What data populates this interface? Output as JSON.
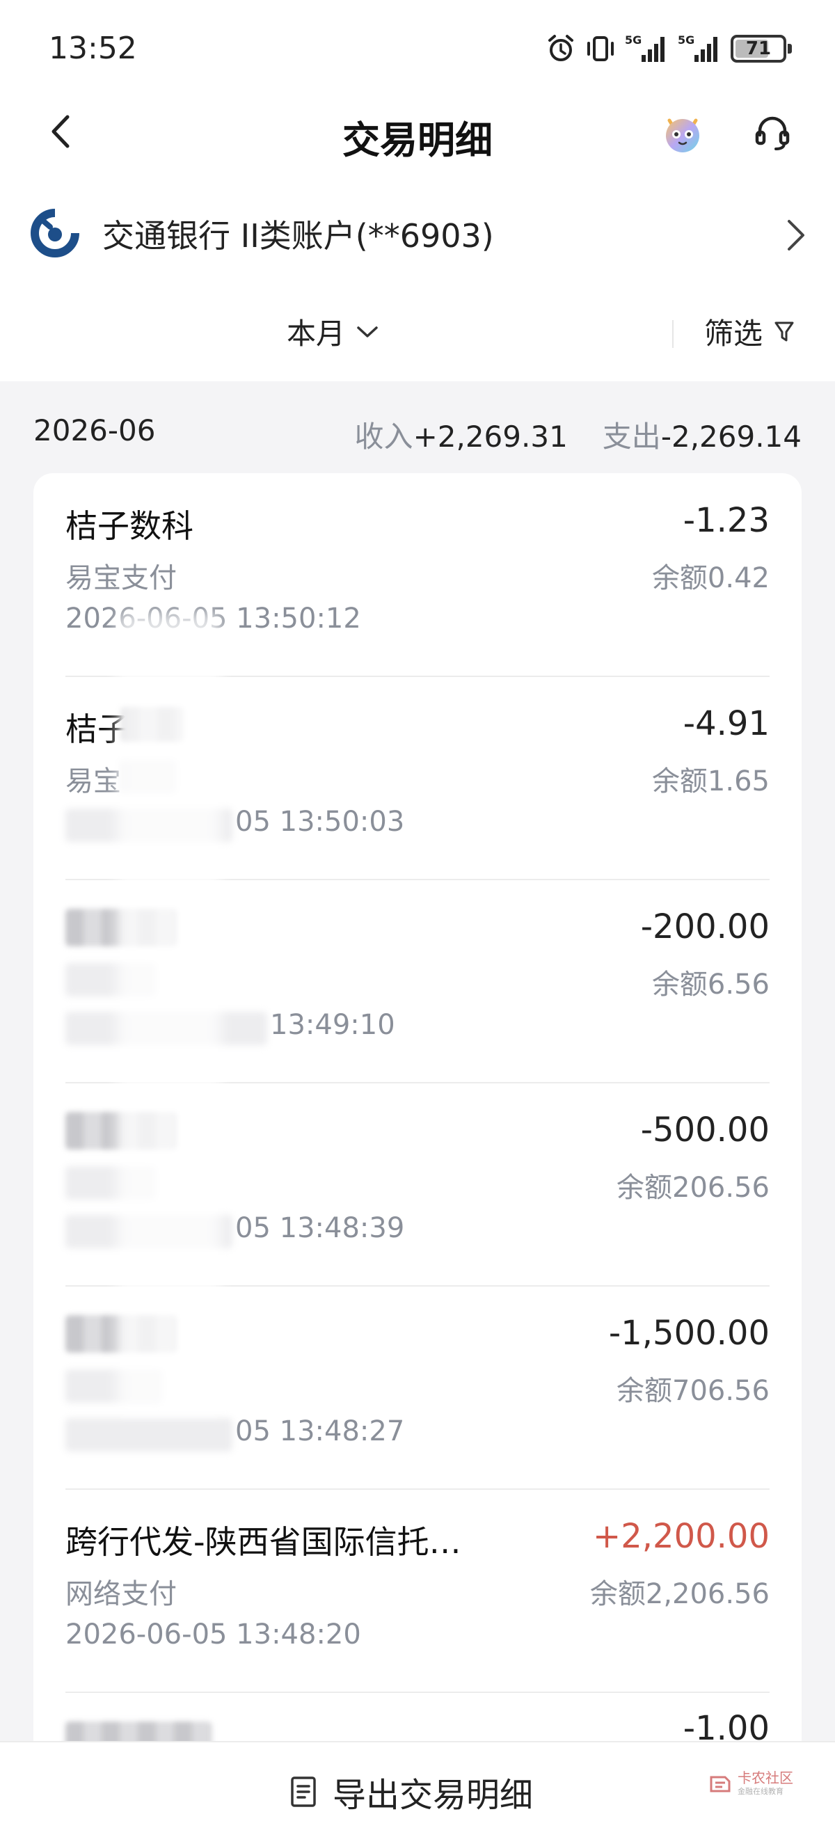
{
  "status_bar": {
    "time": "13:52",
    "battery": "71",
    "battery_level": 0.71,
    "network_1": "5G",
    "network_2": "5G"
  },
  "header": {
    "title": "交易明细",
    "back_icon": "chevron-left-icon",
    "service_icon": "headset-icon",
    "mascot_icon": "mascot-icon"
  },
  "account": {
    "name": "交通银行 II类账户(**6903)",
    "logo_icon": "bocom-logo-icon"
  },
  "filters": {
    "period": "本月",
    "filter": "筛选"
  },
  "summary": {
    "month": "2026-06",
    "income_label": "收入",
    "income_value": "+2,269.31",
    "expense_label": "支出",
    "expense_value": "-2,269.14"
  },
  "transactions": [
    {
      "name": "桔子数科",
      "channel": "易宝支付",
      "time": "2026-06-05 13:50:12",
      "amount": "-1.23",
      "balance": "余额0.42",
      "type": "expense"
    },
    {
      "name": "桔子",
      "channel": "易宝",
      "time": "05 13:50:03",
      "amount": "-4.91",
      "balance": "余额1.65",
      "type": "expense"
    },
    {
      "name": "",
      "channel": "",
      "time": "13:49:10",
      "amount": "-200.00",
      "balance": "余额6.56",
      "type": "expense"
    },
    {
      "name": "",
      "channel": "",
      "time": "05 13:48:39",
      "amount": "-500.00",
      "balance": "余额206.56",
      "type": "expense"
    },
    {
      "name": "",
      "channel": "",
      "time": "05 13:48:27",
      "amount": "-1,500.00",
      "balance": "余额706.56",
      "type": "expense"
    },
    {
      "name": "跨行代发-陕西省国际信托…",
      "channel": "网络支付",
      "time": "2026-06-05 13:48:20",
      "amount": "+2,200.00",
      "balance": "余额2,206.56",
      "type": "income"
    },
    {
      "name": "",
      "channel": "",
      "time": "",
      "amount": "-1.00",
      "balance": "",
      "type": "expense"
    }
  ],
  "bottom": {
    "export_label": "导出交易明细",
    "export_icon": "document-icon"
  },
  "watermark": {
    "text": "卡农社区",
    "sub": "金融在线教育"
  },
  "colors": {
    "income": "#d0584a",
    "secondary_text": "#8a8f99",
    "background": "#f4f4f6",
    "brand": "#1d4e89"
  }
}
